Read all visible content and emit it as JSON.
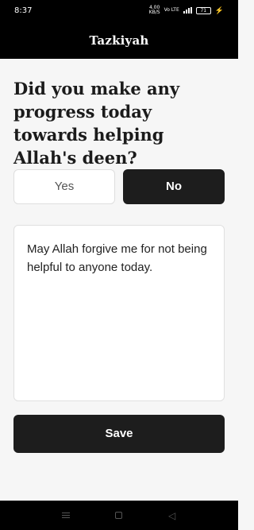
{
  "status_bar": {
    "time": "8:37",
    "speed_value": "4.00",
    "speed_unit": "KB/S",
    "network": "Vo LTE",
    "battery": "71"
  },
  "header": {
    "title": "Tazkiyah"
  },
  "main": {
    "question": "Did you make any progress today towards helping Allah's deen?",
    "options": [
      {
        "label": "Yes",
        "selected": false
      },
      {
        "label": "No",
        "selected": true
      }
    ],
    "note_text": "May Allah forgive me for not being helpful to anyone today.",
    "save_label": "Save"
  },
  "nav": {
    "back_glyph": "◁"
  },
  "colors": {
    "background": "#f6f6f6",
    "primary": "#1d1d1d",
    "bars": "#000000"
  }
}
